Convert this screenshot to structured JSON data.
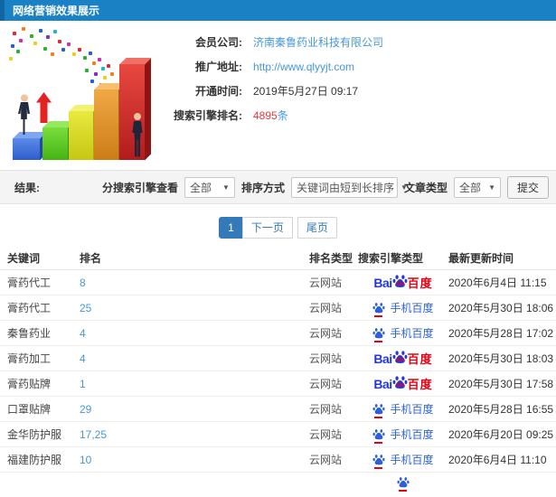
{
  "header": {
    "title": "网络营销效果展示"
  },
  "info": {
    "company_label": "会员公司:",
    "company_value": "济南秦鲁药业科技有限公司",
    "url_label": "推广地址:",
    "url_value": "http://www.qlyyjt.com",
    "opened_label": "开通时间:",
    "opened_value": "2019年5月27日 09:17",
    "rank_label": "搜索引擎排名:",
    "rank_count": "4895",
    "rank_unit": "条"
  },
  "filters": {
    "result_label": "结果:",
    "engine_filter_label": "分搜索引擎查看",
    "engine_filter_value": "全部",
    "sort_label": "排序方式",
    "sort_value": "关键词由短到长排序",
    "article_type_label": "文章类型",
    "article_type_value": "全部",
    "submit_label": "提交"
  },
  "pagination": {
    "current": "1",
    "next_label": "下一页",
    "last_label": "尾页"
  },
  "table": {
    "headers": [
      "关键词",
      "排名",
      "排名类型",
      "搜索引擎类型",
      "最新更新时间"
    ],
    "rows": [
      {
        "keyword": "膏药代工",
        "rank": "8",
        "rank_type": "云网站",
        "engine": "baidu",
        "engine_name": "百度",
        "updated": "2020年6月4日 11:15"
      },
      {
        "keyword": "膏药代工",
        "rank": "25",
        "rank_type": "云网站",
        "engine": "mobile",
        "engine_name": "手机百度",
        "updated": "2020年5月30日 18:06"
      },
      {
        "keyword": "秦鲁药业",
        "rank": "4",
        "rank_type": "云网站",
        "engine": "mobile",
        "engine_name": "手机百度",
        "updated": "2020年5月28日 17:02"
      },
      {
        "keyword": "膏药加工",
        "rank": "4",
        "rank_type": "云网站",
        "engine": "baidu",
        "engine_name": "百度",
        "updated": "2020年5月30日 18:03"
      },
      {
        "keyword": "膏药贴牌",
        "rank": "1",
        "rank_type": "云网站",
        "engine": "baidu",
        "engine_name": "百度",
        "updated": "2020年5月30日 17:58"
      },
      {
        "keyword": "口罩贴牌",
        "rank": "29",
        "rank_type": "云网站",
        "engine": "mobile",
        "engine_name": "手机百度",
        "updated": "2020年5月28日 16:55"
      },
      {
        "keyword": "金华防护服",
        "rank": "17,25",
        "rank_type": "云网站",
        "engine": "mobile",
        "engine_name": "手机百度",
        "updated": "2020年6月20日 09:25"
      },
      {
        "keyword": "福建防护服",
        "rank": "10",
        "rank_type": "云网站",
        "engine": "mobile",
        "engine_name": "手机百度",
        "updated": "2020年6月4日 11:10"
      }
    ]
  },
  "logos": {
    "baidu_bai": "Bai",
    "baidu_du": "du",
    "baidu_cn": "百度",
    "mobile_label": "手机百度"
  },
  "colors": {
    "topbar_blue": "#1a81c5",
    "link_blue": "#4697d9",
    "count_red": "#e4393c",
    "pagination_blue": "#337ab7",
    "baidu_blue": "#2438d8",
    "baidu_red": "#e60012"
  }
}
